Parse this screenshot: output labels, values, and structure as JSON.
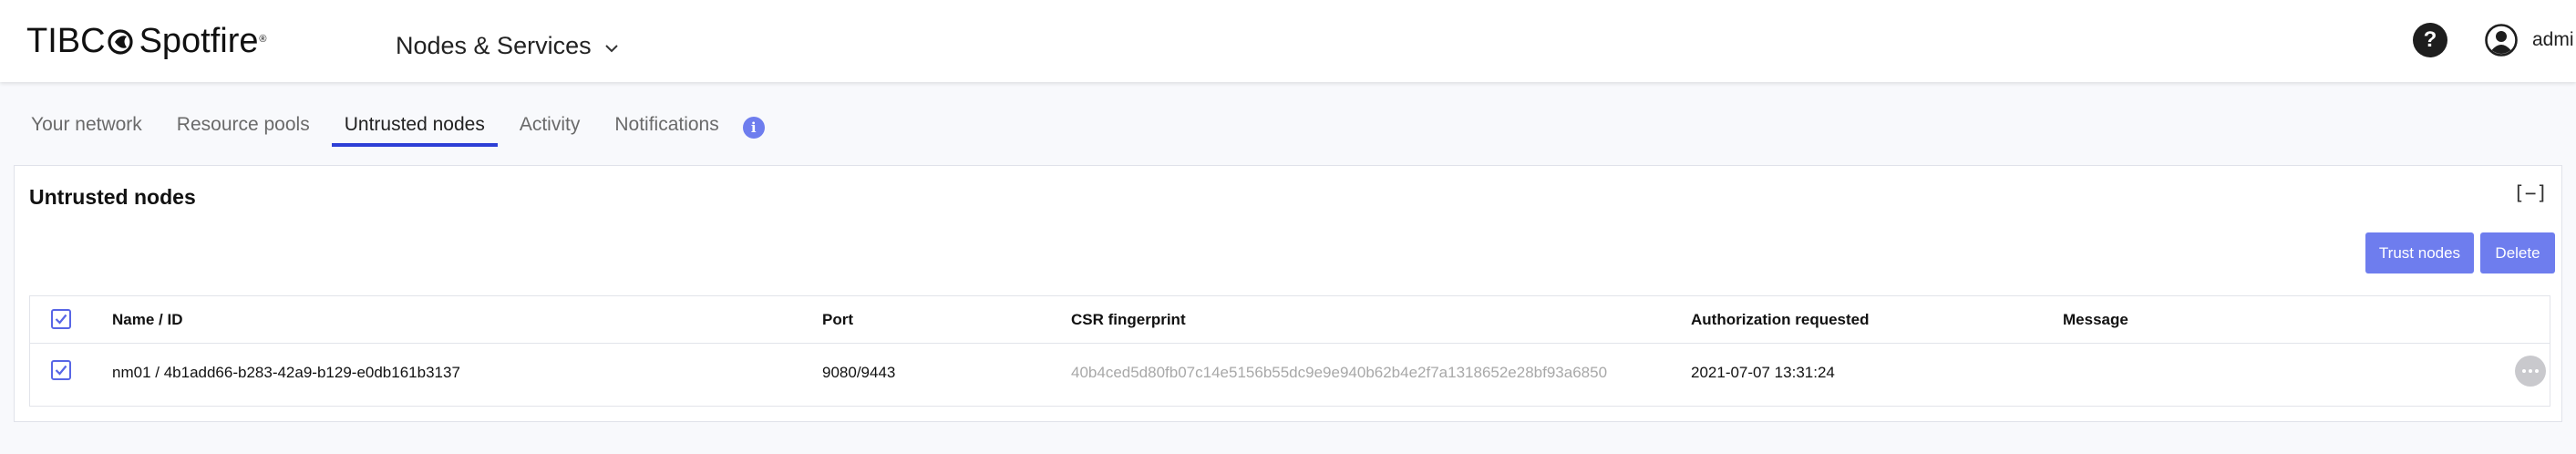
{
  "header": {
    "logo_text_tibco": "TIBC",
    "logo_text_spotfire": "Spotfire",
    "logo_registered": "®",
    "app_title": "Nodes & Services",
    "help_label": "?",
    "user_name": "admi"
  },
  "tabs": [
    {
      "label": "Your network",
      "active": false
    },
    {
      "label": "Resource pools",
      "active": false
    },
    {
      "label": "Untrusted nodes",
      "active": true
    },
    {
      "label": "Activity",
      "active": false
    },
    {
      "label": "Notifications",
      "active": false
    }
  ],
  "info_icon_glyph": "i",
  "panel": {
    "title": "Untrusted nodes",
    "collapse_label": "[−]",
    "trust_button": "Trust nodes",
    "delete_button": "Delete"
  },
  "table": {
    "columns": [
      "Name / ID",
      "Port",
      "CSR fingerprint",
      "Authorization requested",
      "Message"
    ],
    "header_checked": true,
    "rows": [
      {
        "checked": true,
        "name": "nm01",
        "separator": " / ",
        "id": "4b1add66-b283-42a9-b129-e0db161b3137",
        "port": "9080/9443",
        "fingerprint": "40b4ced5d80fb07c14e5156b55dc9e9e940b62b4e2f7a1318652e28bf93a6850",
        "requested": "2021-07-07 13:31:24",
        "message": ""
      }
    ]
  },
  "colors": {
    "accent": "#2d3fd6",
    "button": "#6e7dee",
    "fingerprint_text": "#a8a8a8"
  }
}
